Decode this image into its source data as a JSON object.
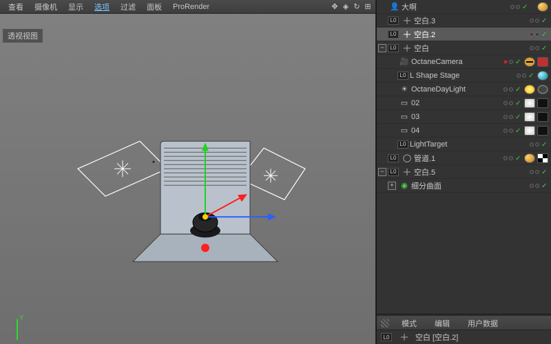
{
  "menu": {
    "view": "查看",
    "camera": "摄像机",
    "display": "显示",
    "options": "选项",
    "filter": "过滤",
    "panel": "面板",
    "renderer": "ProRender"
  },
  "viewport": {
    "label": "透视视图"
  },
  "tree": {
    "r0": {
      "name": "大啊"
    },
    "r1": {
      "name": "空白.3"
    },
    "r2": {
      "name": "空白.2"
    },
    "r3": {
      "name": "空白"
    },
    "r4": {
      "name": "OctaneCamera"
    },
    "r5": {
      "name": "L Shape Stage"
    },
    "r6": {
      "name": "OctaneDayLight"
    },
    "r7": {
      "name": "02"
    },
    "r8": {
      "name": "03"
    },
    "r9": {
      "name": "04"
    },
    "r10": {
      "name": "LightTarget"
    },
    "r11": {
      "name": "管道.1"
    },
    "r12": {
      "name": "空白.5"
    },
    "r13": {
      "name": "细分曲面"
    }
  },
  "attr": {
    "mode": "模式",
    "edit": "编辑",
    "userdata": "用户数据",
    "obj_label": "空白 [空白.2]"
  },
  "layer_badge": "L0"
}
